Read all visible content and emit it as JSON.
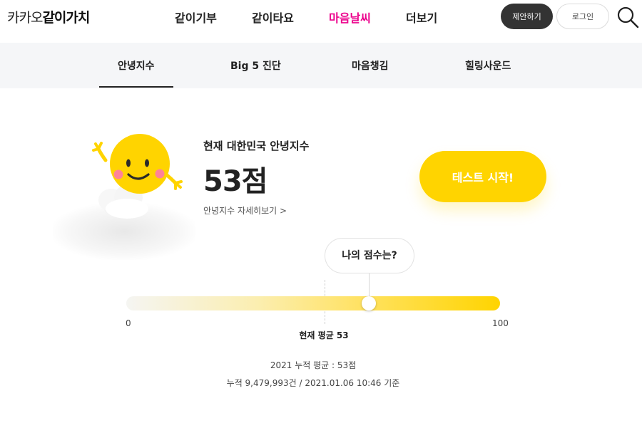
{
  "header": {
    "logo_light": "카카오",
    "logo_bold": "같이가치",
    "nav": [
      "같이기부",
      "같이타요",
      "마음날씨",
      "더보기"
    ],
    "active_nav": "마음날씨",
    "propose_label": "제안하기",
    "login_label": "로그인",
    "search_icon": "search-icon"
  },
  "subnav": {
    "items": [
      "안녕지수",
      "Big 5 진단",
      "마음챙김",
      "힐링사운드"
    ],
    "active": "안녕지수"
  },
  "hero": {
    "label": "현재 대한민국 안녕지수",
    "score": "53점",
    "detail_link": "안녕지수 자세히보기 >",
    "start_button": "테스트 시작!",
    "mascot_icon": "smiling-sun-icon"
  },
  "score_gauge": {
    "bubble": "나의 점수는?",
    "min": "0",
    "max": "100",
    "average_label": "현재 평균 53",
    "average_value": 53,
    "my_score_position": 65
  },
  "stats": {
    "line1": "2021 누적 평균 : 53점",
    "line2": "누적 9,479,993건 / 2021.01.06 10:46 기준"
  },
  "colors": {
    "accent_pink": "#ec008c",
    "accent_yellow": "#ffd400",
    "dark_button": "#333333"
  }
}
